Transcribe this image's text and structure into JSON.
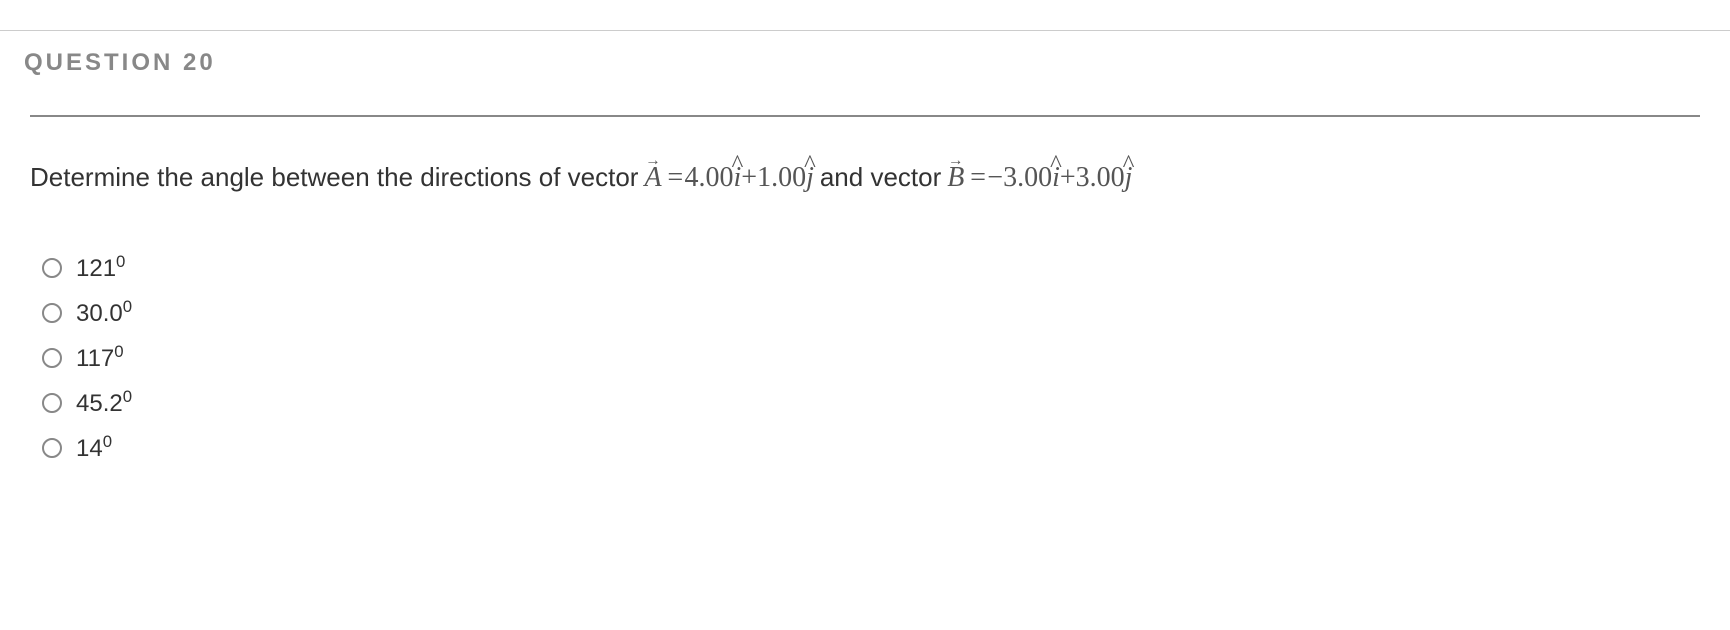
{
  "header": "QUESTION 20",
  "question": {
    "prefix": "Determine the angle between the directions of vector ",
    "vecA_sym": "A",
    "eq1": "= ",
    "A_i": "4.00",
    "ihat1": "i",
    "plus1": " + ",
    "A_j": "1.00",
    "jhat1": "j",
    "mid": "and vector ",
    "vecB_sym": "B",
    "eq2": "= ",
    "neg": "− ",
    "B_i": "3.00",
    "ihat2": "i",
    "plus2": " + ",
    "B_j": "3.00",
    "jhat2": "j"
  },
  "options": [
    {
      "base": "121",
      "sup": "0"
    },
    {
      "base": "30.0",
      "sup": "0"
    },
    {
      "base": "117",
      "sup": "0"
    },
    {
      "base": "45.2",
      "sup": "0"
    },
    {
      "base": "14",
      "sup": "0"
    }
  ]
}
